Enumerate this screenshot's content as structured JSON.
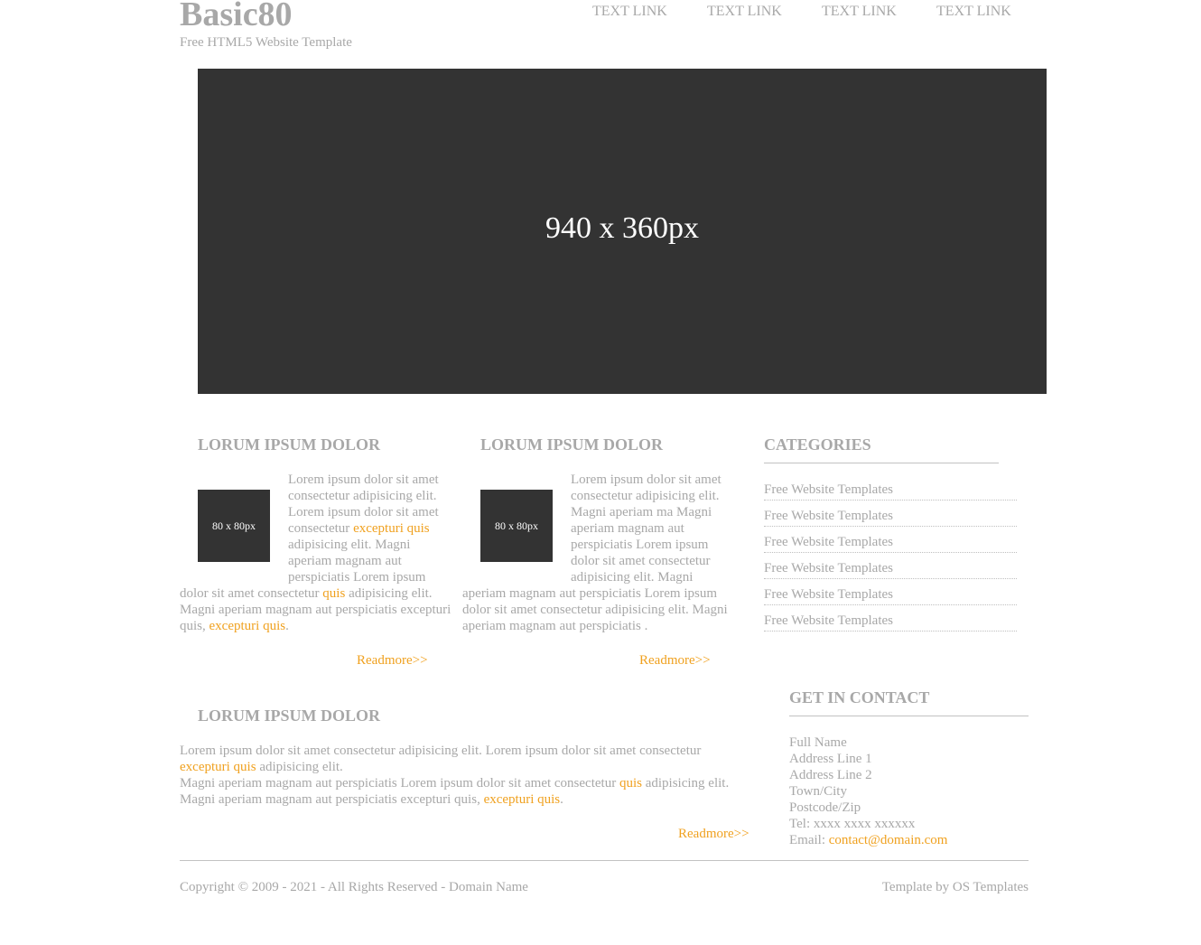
{
  "header": {
    "title": "Basic80",
    "tagline": "Free HTML5 Website Template",
    "nav": [
      "TEXT LINK",
      "TEXT LINK",
      "TEXT LINK",
      "TEXT LINK"
    ]
  },
  "hero": {
    "label": "940 x 360px"
  },
  "columns": [
    {
      "heading": "LORUM IPSUM DOLOR",
      "thumb": "80 x 80px",
      "p1": "Lorem ipsum dolor sit amet consectetur adipisicing elit. Lorem ipsum dolor sit amet consectetur ",
      "link1": "excepturi quis",
      "p2": " adipisicing elit. Magni aperiam magnam aut perspiciatis Lorem ipsum dolor sit amet consectetur ",
      "link2": "quis",
      "p3": " adipisicing elit. Magni aperiam magnam aut perspiciatis excepturi quis, ",
      "link3": "excepturi quis",
      "p4": ".",
      "readmore": "Readmore>>"
    },
    {
      "heading": "LORUM IPSUM DOLOR",
      "thumb": "80 x 80px",
      "text": "Lorem ipsum dolor sit amet consectetur adipisicing elit. Magni aperiam ma Magni aperiam magnam aut perspiciatis Lorem ipsum dolor sit amet consectetur adipisicing elit. Magni aperiam magnam aut perspiciatis Lorem ipsum dolor sit amet consectetur adipisicing elit. Magni aperiam magnam aut perspiciatis .",
      "readmore": "Readmore>>"
    }
  ],
  "wide": {
    "heading": "LORUM IPSUM DOLOR",
    "l1a": "Lorem ipsum dolor sit amet consectetur adipisicing elit. Lorem ipsum dolor sit amet consectetur",
    "l2link": "excepturi quis",
    "l2b": " adipisicing elit.",
    "l3a": "Magni aperiam magnam aut perspiciatis Lorem ipsum dolor sit amet consectetur ",
    "l3link": "quis",
    "l3b": " adipisicing elit.",
    "l4a": "Magni aperiam magnam aut perspiciatis excepturi quis, ",
    "l4link": "excepturi quis",
    "l4b": ".",
    "readmore": "Readmore>>"
  },
  "categories": {
    "heading": "CATEGORIES",
    "items": [
      "Free Website Templates",
      "Free Website Templates",
      "Free Website Templates",
      "Free Website Templates",
      "Free Website Templates",
      "Free Website Templates"
    ]
  },
  "contact": {
    "heading": "GET IN CONTACT",
    "lines": [
      "Full Name",
      "Address Line 1",
      "Address Line 2",
      "Town/City",
      "Postcode/Zip",
      "Tel: xxxx xxxx xxxxxx"
    ],
    "email_label": "Email: ",
    "email": "contact@domain.com"
  },
  "footer": {
    "copyright": "Copyright © 2009 - 2021 - All Rights Reserved - Domain Name",
    "credit": "Template by OS Templates"
  },
  "colors": {
    "text": "#a8a8a8",
    "link": "#f0a11f",
    "placeholder": "#333333"
  }
}
